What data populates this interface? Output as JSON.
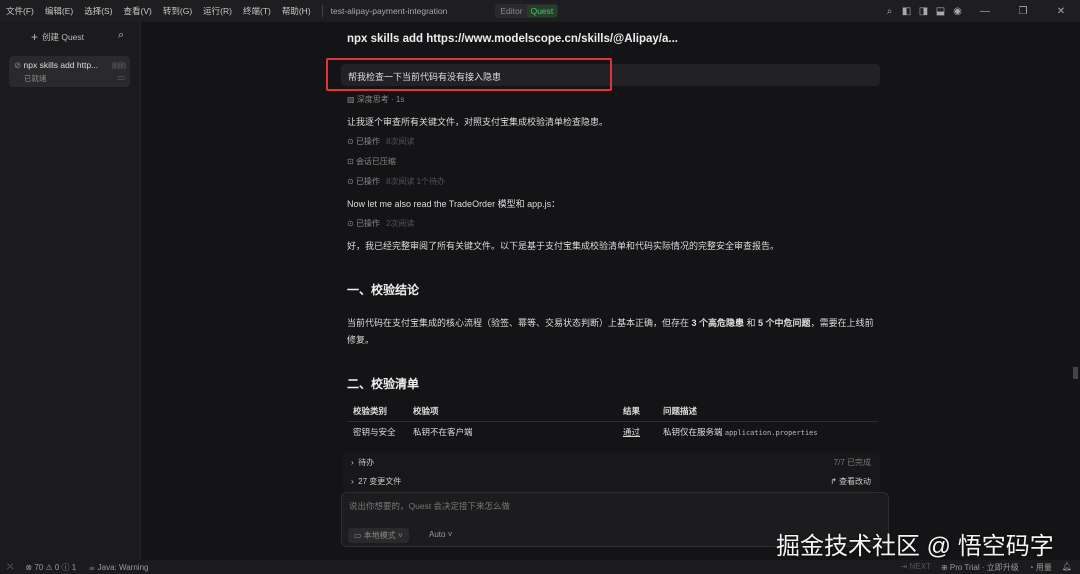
{
  "menu": [
    "文件(F)",
    "编辑(E)",
    "选择(S)",
    "查看(V)",
    "转到(G)",
    "运行(R)",
    "终端(T)",
    "帮助(H)"
  ],
  "project": "test-alipay-payment-integration",
  "modes": {
    "editor": "Editor",
    "quest": "Quest"
  },
  "sidebar": {
    "new_label": "创建 Quest",
    "item": {
      "title": "npx skills add http...",
      "status": "已就绪",
      "tag": "刚刚"
    }
  },
  "chat": {
    "title": "npx skills add https://www.modelscope.cn/skills/@Alipay/a...",
    "user_msg": "帮我检查一下当前代码有没有接入隐患",
    "thinking": "深度思考 · 1s",
    "p1": "让我逐个审查所有关键文件，对照支付宝集成校验清单检查隐患。",
    "op1": {
      "label": "已操作",
      "detail": "8次阅读"
    },
    "compressed": "会话已压缩",
    "op2": {
      "label": "已操作",
      "detail": "8次阅读 1个待办"
    },
    "p2": "Now let me also read the TradeOrder 模型和 app.js：",
    "op3": {
      "label": "已操作",
      "detail": "2次阅读"
    },
    "p3": "好，我已经完整审阅了所有关键文件。以下是基于支付宝集成校验清单和代码实际情况的完整安全审查报告。",
    "h1": "一、校验结论",
    "c1": "当前代码在支付宝集成的核心流程（验签、幂等、交易状态判断）上基本正确，但存在 ",
    "c2": "3 个高危隐患",
    "c3": " 和 ",
    "c4": "5 个中危问题",
    "c5": "，需要在上线前修复。",
    "h2": "二、校验清单",
    "table": {
      "headers": [
        "校验类别",
        "校验项",
        "结果",
        "问题描述"
      ],
      "row": [
        "密钥与安全",
        "私钥不在客户端",
        "通过",
        "私钥仅在服务端 ",
        "application.properties"
      ]
    },
    "todo": {
      "label": "待办",
      "progress": "7/7 已完成"
    },
    "files": {
      "label": "27 变更文件",
      "action": "查看改动"
    }
  },
  "input": {
    "placeholder": "说出你想要的，Quest 会决定接下来怎么做",
    "mode": "本地模式",
    "model": "Auto"
  },
  "watermark": "掘金技术社区 @ 悟空码字",
  "status": {
    "errors": "70",
    "warnings": "0",
    "info": "1",
    "java": "Java: Warning",
    "next": "NEXT",
    "trial": "Pro Trial · 立即升级",
    "usage": "用量"
  }
}
